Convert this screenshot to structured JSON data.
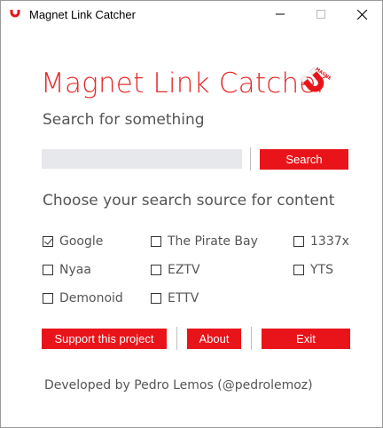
{
  "window": {
    "title": "Magnet Link Catcher",
    "controls": {
      "minimize": "minimize-icon",
      "maximize": "maximize-icon",
      "close": "close-icon"
    }
  },
  "header": {
    "heading": "Magnet Link Catcher",
    "logo_text": "MAGNET",
    "subtitle": "Search for something"
  },
  "search": {
    "value": "",
    "placeholder": "",
    "button_label": "Search"
  },
  "sources": {
    "title": "Choose your search source for content",
    "options": [
      {
        "label": "Google",
        "checked": true
      },
      {
        "label": "The Pirate Bay",
        "checked": false
      },
      {
        "label": "1337x",
        "checked": false
      },
      {
        "label": "Nyaa",
        "checked": false
      },
      {
        "label": "EZTV",
        "checked": false
      },
      {
        "label": "YTS",
        "checked": false
      },
      {
        "label": "Demonoid",
        "checked": false
      },
      {
        "label": "ETTV",
        "checked": false
      }
    ]
  },
  "actions": {
    "support_label": "Support this project",
    "about_label": "About",
    "exit_label": "Exit"
  },
  "footer": {
    "credit": "Developed by Pedro Lemos (@pedrolemoz)"
  },
  "colors": {
    "accent": "#e8141a",
    "heading": "#e52b2b",
    "input_bg": "#e6e8ec",
    "text_muted": "#555555"
  }
}
